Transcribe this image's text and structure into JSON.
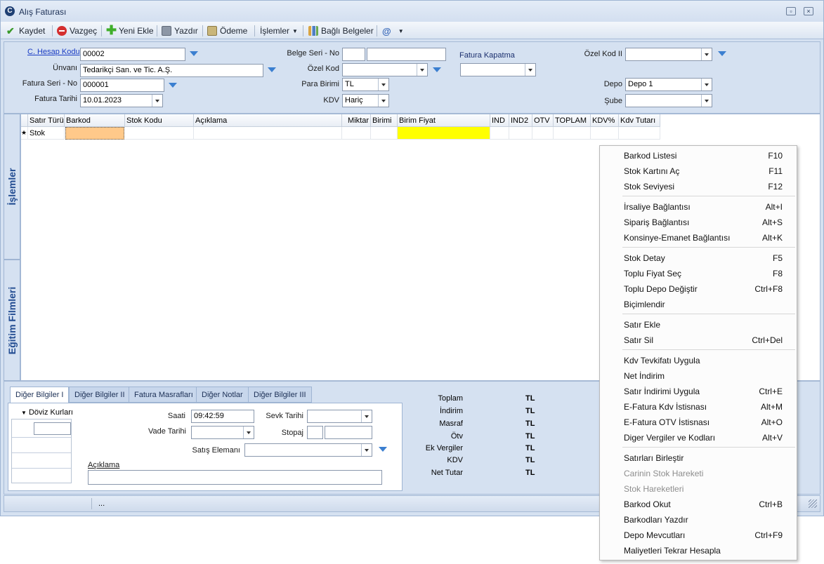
{
  "window": {
    "title": "Alış Faturası",
    "logo": "C"
  },
  "toolbar": {
    "save": "Kaydet",
    "cancel": "Vazgeç",
    "new": "Yeni Ekle",
    "print": "Yazdır",
    "payment": "Ödeme",
    "operations": "İşlemler",
    "linked_docs": "Bağlı Belgeler"
  },
  "form": {
    "account_code_label": "C. Hesap Kodu",
    "account_code": "00002",
    "title_label": "Ünvanı",
    "title": "Tedarikçi San. ve Tic. A.Ş.",
    "invoice_serial_label": "Fatura Seri - No",
    "invoice_serial": "000001",
    "invoice_date_label": "Fatura Tarihi",
    "invoice_date": "10.01.2023",
    "doc_serial_label": "Belge Seri - No",
    "special_code_label": "Özel Kod",
    "currency_label": "Para Birimi",
    "currency": "TL",
    "vat_label": "KDV",
    "vat": "Hariç",
    "invoice_closing_label": "Fatura Kapatma",
    "special_code2_label": "Özel Kod II",
    "warehouse_label": "Depo",
    "warehouse": "Depo 1",
    "branch_label": "Şube"
  },
  "side_tabs": {
    "operations": "İşlemler",
    "training": "Eğitim Filmleri"
  },
  "grid": {
    "columns": [
      "Satır Türü",
      "Barkod",
      "Stok Kodu",
      "Açıklama",
      "Miktar",
      "Birimi",
      "Birim Fiyat",
      "IND",
      "IND2",
      "OTV",
      "TOPLAM",
      "KDV%",
      "Kdv Tutarı"
    ],
    "row_marker": "★",
    "row_type": "Stok"
  },
  "bottom": {
    "tabs": [
      "Diğer Bilgiler I",
      "Diğer Bilgiler II",
      "Fatura Masrafları",
      "Diğer Notlar",
      "Diğer Bilgiler III"
    ],
    "fx_label": "Döviz Kurları",
    "time_label": "Saati",
    "time": "09:42:59",
    "ship_date_label": "Sevk Tarihi",
    "due_date_label": "Vade Tarihi",
    "withholding_label": "Stopaj",
    "sales_rep_label": "Satış Elemanı",
    "note_label": "Açıklama"
  },
  "totals": [
    {
      "label": "Toplam",
      "value": "TL"
    },
    {
      "label": "İndirim",
      "value": "TL"
    },
    {
      "label": "Masraf",
      "value": "TL"
    },
    {
      "label": "Ötv",
      "value": "TL"
    },
    {
      "label": "Ek Vergiler",
      "value": "TL"
    },
    {
      "label": "KDV",
      "value": "TL"
    },
    {
      "label": "Net Tutar",
      "value": "TL"
    }
  ],
  "status": {
    "dots": "..."
  },
  "context_menu": {
    "items": [
      {
        "label": "Barkod Listesi",
        "shortcut": "F10"
      },
      {
        "label": "Stok Kartını Aç",
        "shortcut": "F11"
      },
      {
        "label": "Stok Seviyesi",
        "shortcut": "F12"
      },
      {
        "label": "İrsaliye Bağlantısı",
        "shortcut": "Alt+I"
      },
      {
        "label": "Sipariş Bağlantısı",
        "shortcut": "Alt+S"
      },
      {
        "label": "Konsinye-Emanet Bağlantısı",
        "shortcut": "Alt+K"
      },
      {
        "label": "Stok Detay",
        "shortcut": "F5"
      },
      {
        "label": "Toplu Fiyat Seç",
        "shortcut": "F8"
      },
      {
        "label": "Toplu Depo Değiştir",
        "shortcut": "Ctrl+F8"
      },
      {
        "label": "Biçimlendir",
        "shortcut": ""
      },
      {
        "label": "Satır Ekle",
        "shortcut": ""
      },
      {
        "label": "Satır Sil",
        "shortcut": "Ctrl+Del"
      },
      {
        "label": "Kdv Tevkifatı Uygula",
        "shortcut": ""
      },
      {
        "label": "Net İndirim",
        "shortcut": ""
      },
      {
        "label": "Satır İndirimi Uygula",
        "shortcut": "Ctrl+E"
      },
      {
        "label": "E-Fatura Kdv İstisnası",
        "shortcut": "Alt+M"
      },
      {
        "label": "E-Fatura OTV İstisnası",
        "shortcut": "Alt+O"
      },
      {
        "label": "Diger Vergiler ve Kodları",
        "shortcut": "Alt+V"
      },
      {
        "label": "Satırları Birleştir",
        "shortcut": ""
      },
      {
        "label": "Carinin Stok Hareketi",
        "shortcut": ""
      },
      {
        "label": "Stok Hareketleri",
        "shortcut": ""
      },
      {
        "label": "Barkod Okut",
        "shortcut": "Ctrl+B"
      },
      {
        "label": "Barkodları Yazdır",
        "shortcut": ""
      },
      {
        "label": "Depo Mevcutları",
        "shortcut": "Ctrl+F9"
      },
      {
        "label": "Maliyetleri Tekrar Hesapla",
        "shortcut": ""
      }
    ]
  }
}
